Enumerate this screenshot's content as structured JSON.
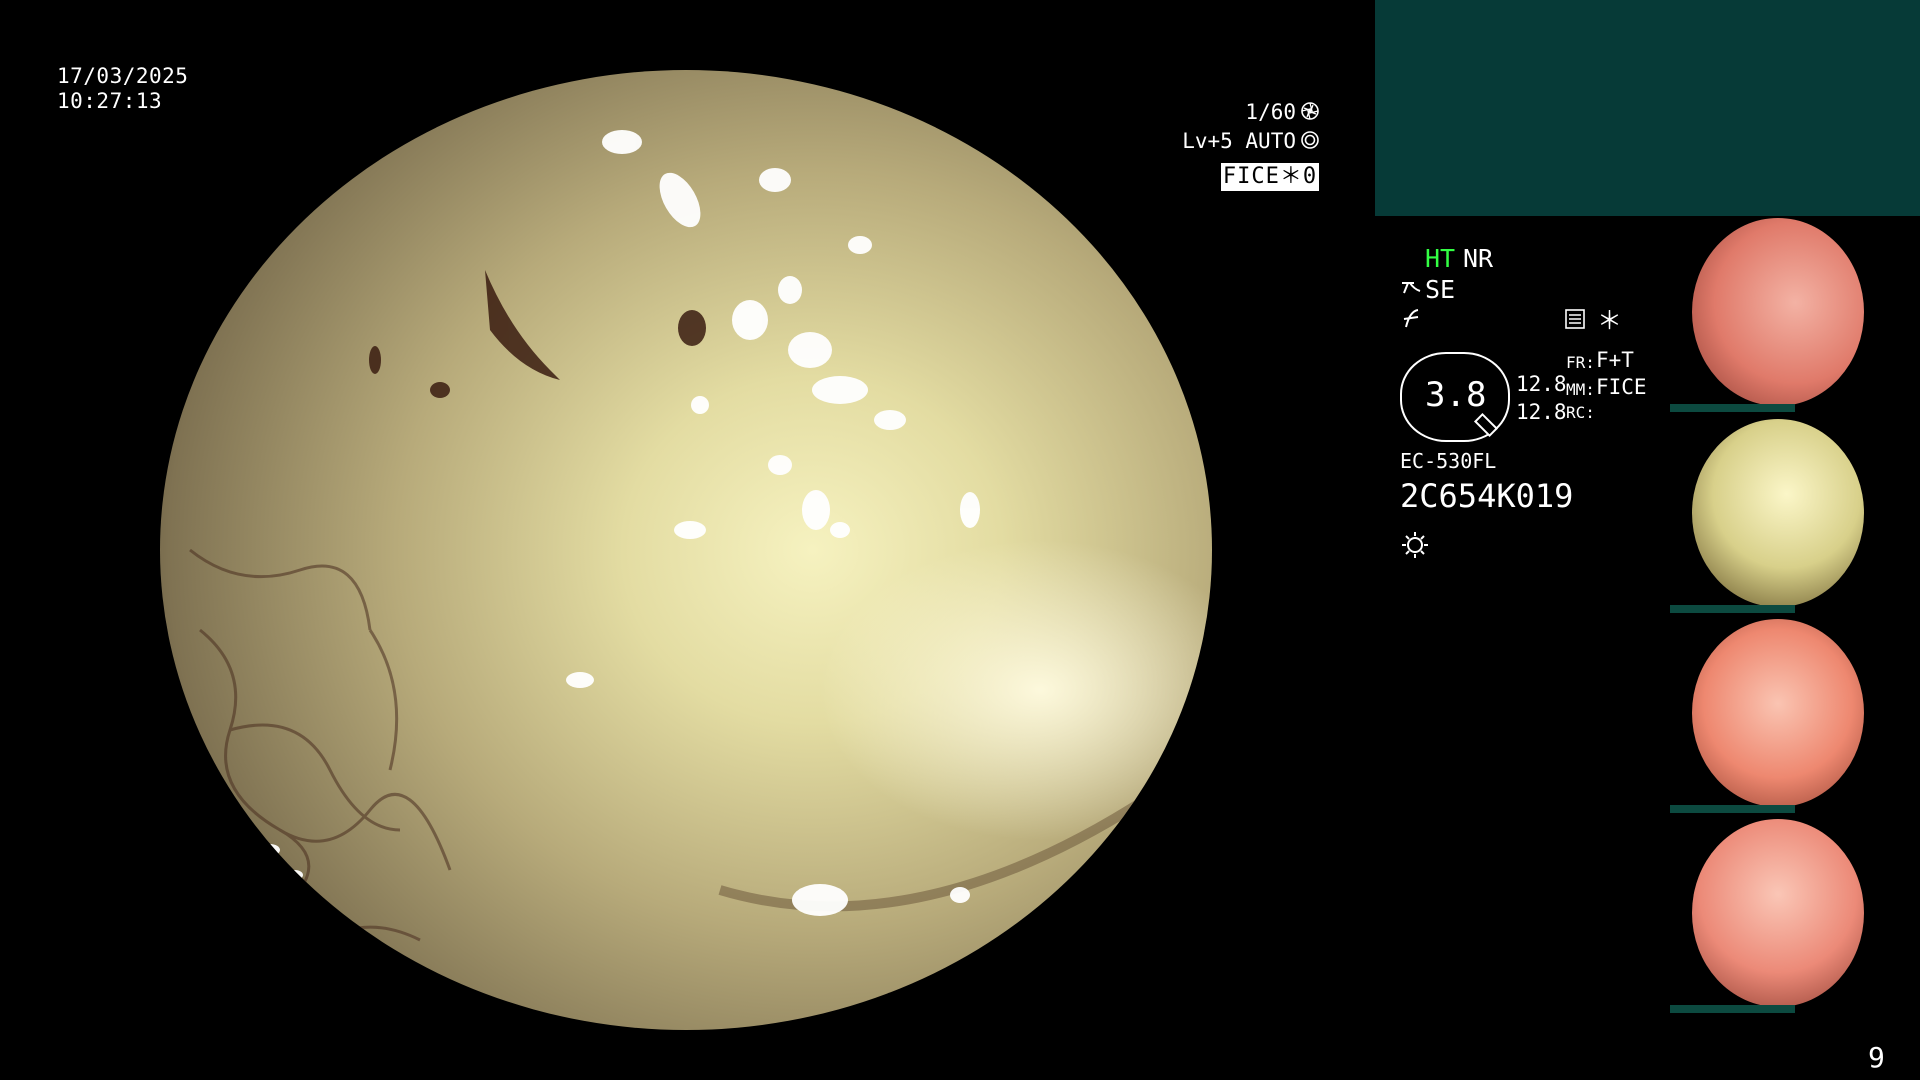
{
  "datetime": {
    "date": "17/03/2025",
    "time": "10:27:13"
  },
  "status": {
    "shutter": "1/60",
    "shutter_icon": "aperture-icon",
    "level_mode": "Lv+5 AUTO",
    "level_icon": "auto-iris-icon",
    "fice_label": "FICE＊0"
  },
  "info": {
    "ht": "HT",
    "nr": "NR",
    "se": "SE",
    "zoom": "3.8",
    "value_top": "12.8",
    "value_bottom": "12.8",
    "fr_label": "FR:",
    "fr_value": "F+T",
    "mm_label": "MM:",
    "mm_value": "FICE",
    "rc_label": "RC:",
    "scope_model": "EC-530FL",
    "serial": "2C654K019",
    "asterisk": "＊"
  },
  "colors": {
    "teal_panel": "#063a37",
    "ht_green": "#33ff44",
    "thumb_bar": "#0c4a40"
  },
  "thumbnails": [
    {
      "label": "capture-1",
      "tone": "#e07a6a"
    },
    {
      "label": "capture-2",
      "tone": "#d8d08a"
    },
    {
      "label": "capture-3",
      "tone": "#ee8870"
    },
    {
      "label": "capture-4",
      "tone": "#ec8a78"
    }
  ],
  "page_number": "9"
}
